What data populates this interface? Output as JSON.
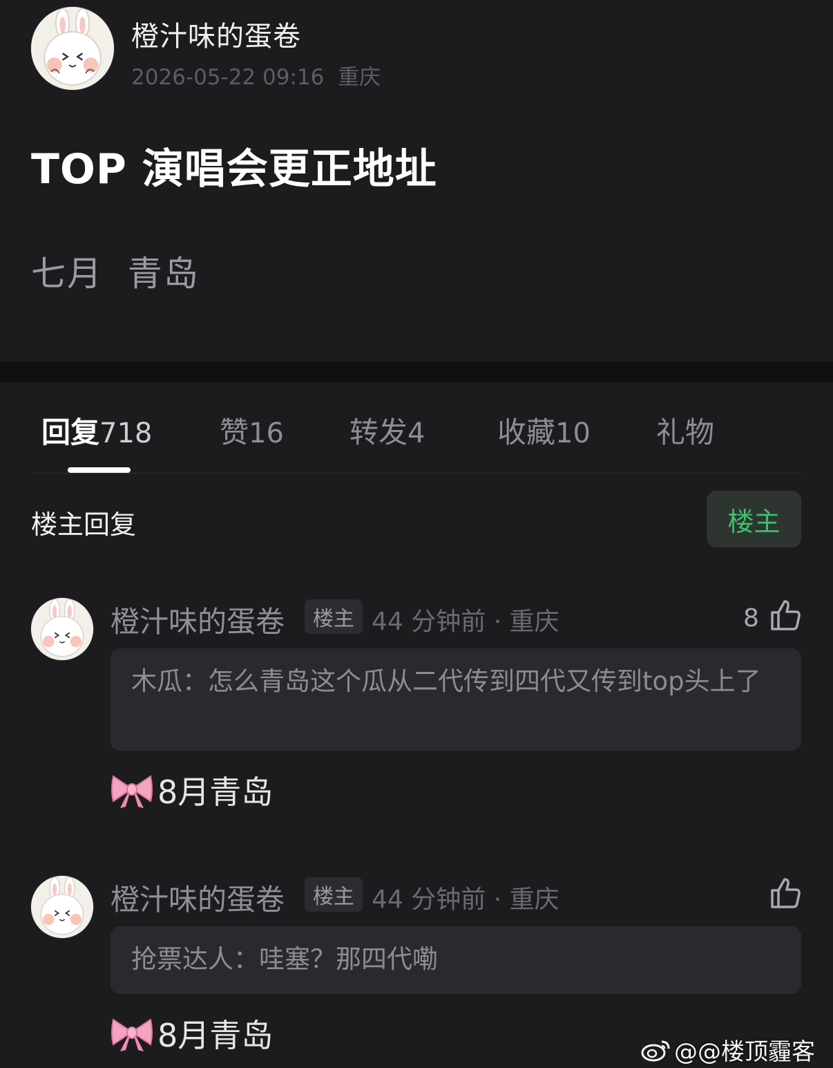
{
  "post": {
    "author": "橙汁味的蛋卷",
    "datetime": "2026-05-22 09:16",
    "location": "重庆",
    "title": "TOP 演唱会更正地址",
    "body": "七月  青岛"
  },
  "tabs": [
    {
      "label": "回复",
      "count": "718",
      "active": true
    },
    {
      "label": "赞",
      "count": "16",
      "active": false
    },
    {
      "label": "转发",
      "count": "4",
      "active": false
    },
    {
      "label": "收藏",
      "count": "10",
      "active": false
    },
    {
      "label": "礼物",
      "count": "",
      "active": false
    }
  ],
  "section": {
    "title": "楼主回复",
    "filter_label": "楼主"
  },
  "comments": [
    {
      "author": "橙汁味的蛋卷",
      "badge": "楼主",
      "time_location": "44 分钟前 · 重庆",
      "likes": "8",
      "quote": "木瓜：怎么青岛这个瓜从二代传到四代又传到top头上了",
      "reply": "8月青岛"
    },
    {
      "author": "橙汁味的蛋卷",
      "badge": "楼主",
      "time_location": "44 分钟前 · 重庆",
      "likes": "",
      "quote": "抢票达人：哇塞？那四代嘞",
      "reply": "8月青岛"
    }
  ],
  "watermark": "@@楼顶霾客",
  "icons": {
    "avatar": "bunny-avatar-icon",
    "like": "thumbs-up-icon",
    "bow": "pink-bow-emoji",
    "weibo": "weibo-logo-icon"
  },
  "colors": {
    "background": "#1c1c1f",
    "accent_green": "#3fbf6a",
    "bow_pink": "#f19ab8"
  }
}
